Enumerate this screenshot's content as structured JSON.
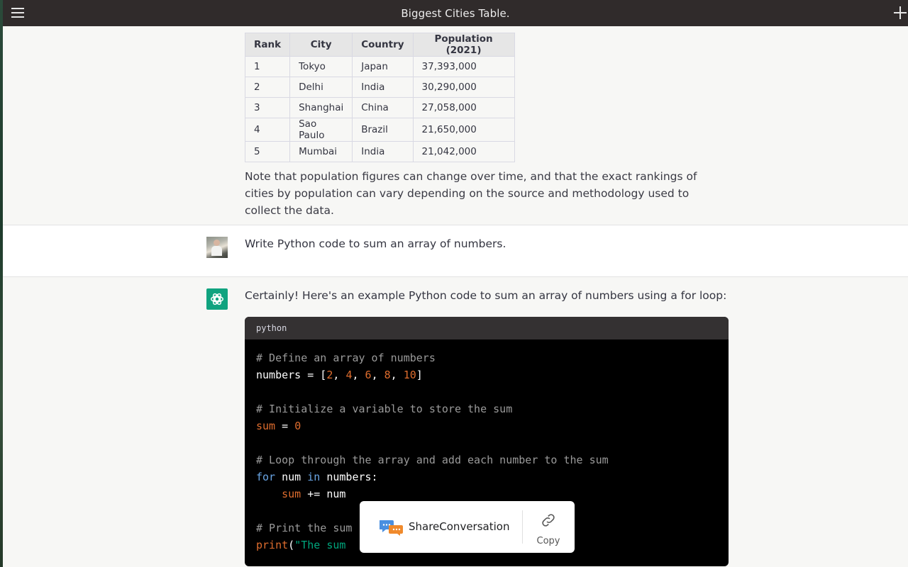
{
  "window": {
    "title": "Biggest Cities Table."
  },
  "table": {
    "headers": [
      "Rank",
      "City",
      "Country",
      "Population (2021)"
    ],
    "rows": [
      [
        "1",
        "Tokyo",
        "Japan",
        "37,393,000"
      ],
      [
        "2",
        "Delhi",
        "India",
        "30,290,000"
      ],
      [
        "3",
        "Shanghai",
        "China",
        "27,058,000"
      ],
      [
        "4",
        "Sao Paulo",
        "Brazil",
        "21,650,000"
      ],
      [
        "5",
        "Mumbai",
        "India",
        "21,042,000"
      ]
    ]
  },
  "note": "Note that population figures can change over time, and that the exact rankings of cities by population can vary depending on the source and methodology used to collect the data.",
  "user_message": "Write Python code to sum an array of numbers.",
  "assistant_message": "Certainly! Here's an example Python code to sum an array of numbers using a for loop:",
  "code": {
    "language": "python",
    "lines": {
      "c1": "# Define an array of numbers",
      "l2_name": "numbers",
      "l2_eq": " = [",
      "n1": "2",
      "n2": "4",
      "n3": "6",
      "n4": "8",
      "n5": "10",
      "c4": "# Initialize a variable to store the sum",
      "l5_var": "sum",
      "l5_eq": " = ",
      "l5_val": "0",
      "c7": "# Loop through the array and add each number to the sum",
      "l8_for": "for",
      "l8_num": " num ",
      "l8_in": "in",
      "l8_rest": " numbers:",
      "l9_indent": "    ",
      "l9_var": "sum",
      "l9_rest": " += num",
      "c11": "# Print the sum",
      "l12_fn": "print",
      "l12_paren": "(",
      "l12_str": "\"The sum "
    }
  },
  "share_popup": {
    "share_label": "ShareConversation",
    "copy_label": "Copy"
  },
  "colors": {
    "accent": "#10a37f",
    "topbar": "#302b2b",
    "code_bg": "#000000"
  }
}
